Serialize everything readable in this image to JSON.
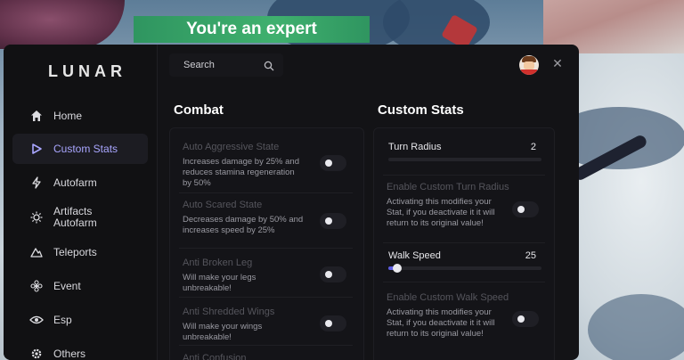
{
  "banner": {
    "text": "You're an expert"
  },
  "app": {
    "title": "LUNAR"
  },
  "sidebar": {
    "items": [
      {
        "label": "Home",
        "icon": "home-icon"
      },
      {
        "label": "Custom Stats",
        "icon": "play-icon",
        "active": true
      },
      {
        "label": "Autofarm",
        "icon": "bolt-icon"
      },
      {
        "label_line1": "Artifacts",
        "label_line2": "Autofarm",
        "icon": "sun-icon"
      },
      {
        "label": "Teleports",
        "icon": "teleport-icon"
      },
      {
        "label": "Event",
        "icon": "flower-icon"
      },
      {
        "label": "Esp",
        "icon": "eye-icon"
      },
      {
        "label": "Others",
        "icon": "gear-icon"
      }
    ]
  },
  "search": {
    "placeholder": "Search"
  },
  "combat": {
    "title": "Combat",
    "options": [
      {
        "title": "Auto Aggressive State",
        "desc": "Increases damage by 25% and reduces stamina regeneration by 50%"
      },
      {
        "title": "Auto Scared State",
        "desc": "Decreases damage by 50% and increases speed by 25%"
      },
      {
        "title": "Anti Broken Leg",
        "desc": "Will make your legs unbreakable!"
      },
      {
        "title": "Anti Shredded Wings",
        "desc": "Will make your wings unbreakable!"
      },
      {
        "title": "Anti Confusion"
      }
    ]
  },
  "custom_stats": {
    "title": "Custom Stats",
    "turn_radius": {
      "label": "Turn Radius",
      "value": "2",
      "fraction": 0.0
    },
    "enable_turn": {
      "title": "Enable Custom Turn Radius",
      "desc": "Activating this modifies your Stat, if you deactivate it it will return to its original value!"
    },
    "walk_speed": {
      "label": "Walk Speed",
      "value": "25",
      "fraction": 0.06
    },
    "enable_walk": {
      "title": "Enable Custom Walk Speed",
      "desc": "Activating this modifies your Stat, if you deactivate it it will return to its original value!"
    }
  },
  "colors": {
    "accent": "#5d5ce0",
    "active_text": "#a9a6ff",
    "banner": "#3fb06e"
  }
}
